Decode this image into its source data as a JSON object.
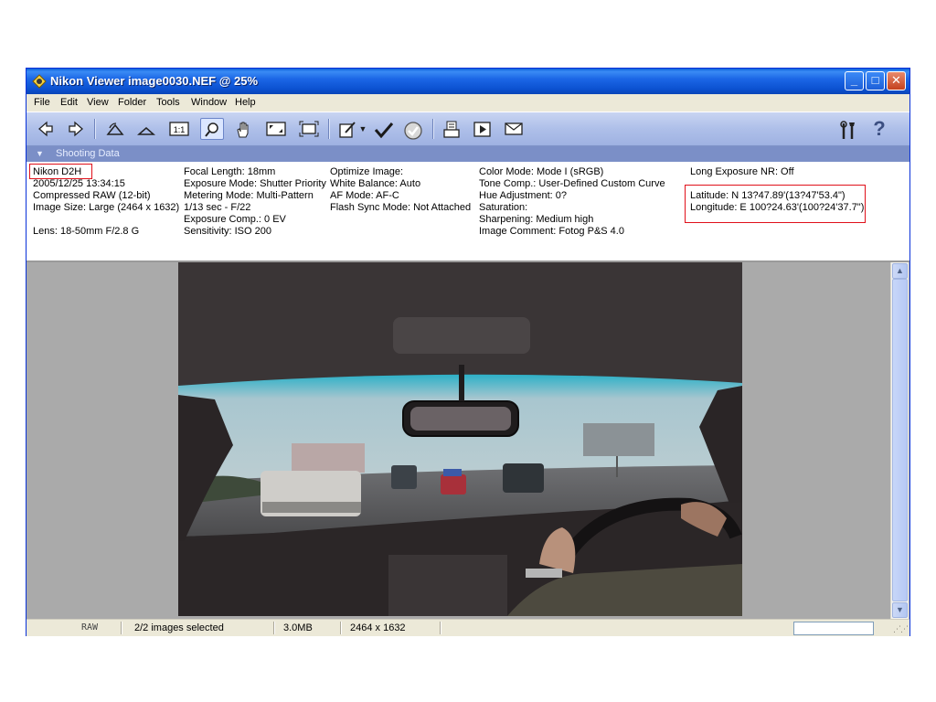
{
  "window": {
    "title": "Nikon Viewer image0030.NEF @ 25%",
    "minimize_glyph": "_",
    "maximize_glyph": "□",
    "close_glyph": "✕"
  },
  "menu": [
    "File",
    "Edit",
    "View",
    "Folder",
    "Tools",
    "Window",
    "Help"
  ],
  "toolbar": {
    "icons": [
      "back-arrow-icon",
      "forward-arrow-icon",
      "rotate-left-icon",
      "rotate-right-icon",
      "actual-size-icon",
      "zoom-icon",
      "hand-icon",
      "fit-screen-icon",
      "full-screen-icon",
      "edit-icon",
      "dropdown-icon",
      "check-icon",
      "protect-icon",
      "print-icon",
      "slideshow-icon",
      "mail-icon",
      "tools-icon",
      "help-icon"
    ],
    "help_glyph": "?"
  },
  "panel": {
    "label": "Shooting Data"
  },
  "shooting_data": {
    "col1": [
      "Nikon D2H",
      "2005/12/25 13:34:15",
      "Compressed RAW (12-bit)",
      "Image Size: Large (2464 x 1632)",
      "",
      "Lens: 18-50mm F/2.8 G"
    ],
    "col2": [
      "Focal Length: 18mm",
      "Exposure Mode: Shutter Priority",
      "Metering Mode: Multi-Pattern",
      "1/13 sec - F/22",
      "Exposure Comp.: 0 EV",
      "Sensitivity: ISO 200"
    ],
    "col3": [
      "Optimize Image:",
      "White Balance: Auto",
      "AF Mode: AF-C",
      "Flash Sync Mode: Not Attached"
    ],
    "col4": [
      "Color Mode: Mode I (sRGB)",
      "Tone Comp.: User-Defined Custom Curve",
      "Hue Adjustment: 0?",
      "Saturation:",
      "Sharpening: Medium high",
      "Image Comment: Fotog P&S 4.0"
    ],
    "col5": [
      "Long Exposure NR: Off",
      "",
      "Latitude: N 13?47.89'(13?47'53.4\")",
      "Longitude: E 100?24.63'(100?24'37.7\")"
    ]
  },
  "scroll": {
    "up_glyph": "▲",
    "down_glyph": "▼"
  },
  "status": {
    "type": "RAW",
    "selection": "2/2 images selected",
    "size": "3.0MB",
    "dimensions": "2464 x 1632",
    "grip_glyph": "⋰⋰"
  },
  "colors": {
    "titlebar": "#0a5fd8",
    "toolbar": "#aebfe9",
    "panel_header": "#7b8fc7",
    "highlight": "#e0101a"
  }
}
